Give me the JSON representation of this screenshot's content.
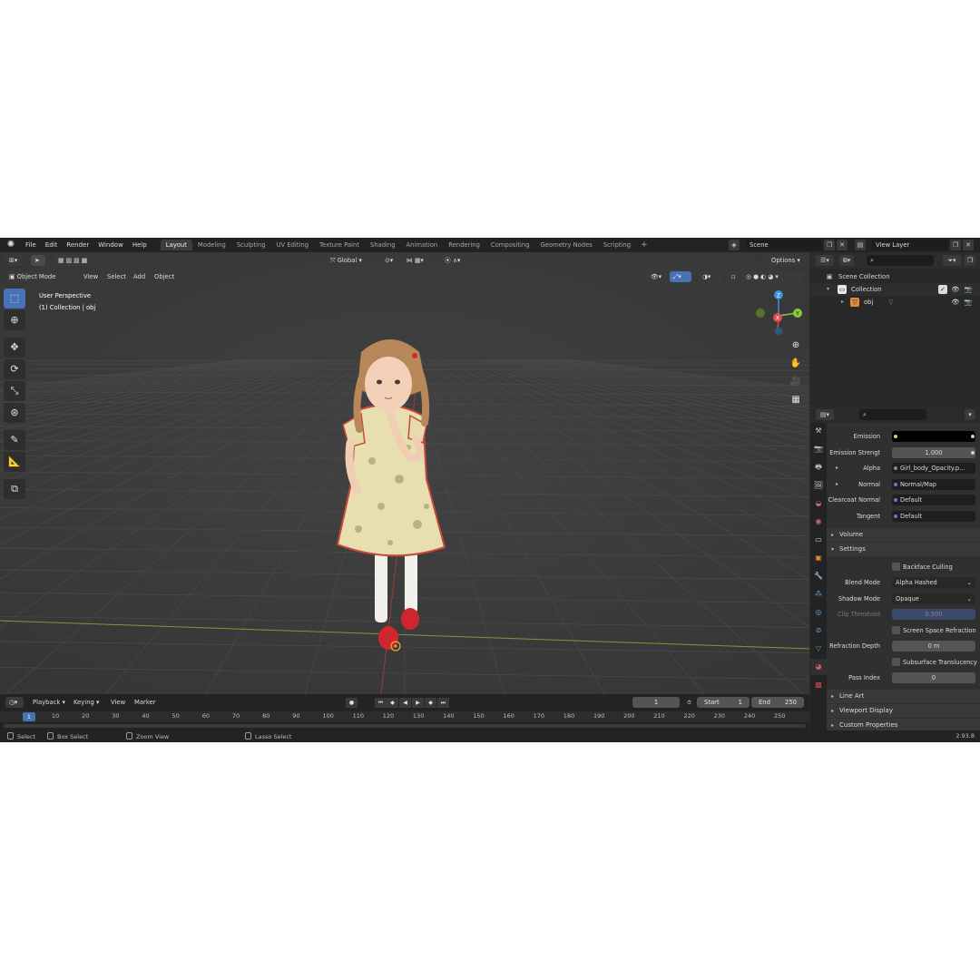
{
  "topbar": {
    "menus": [
      "File",
      "Edit",
      "Render",
      "Window",
      "Help"
    ],
    "workspace_tabs": [
      "Layout",
      "Modeling",
      "Sculpting",
      "UV Editing",
      "Texture Paint",
      "Shading",
      "Animation",
      "Rendering",
      "Compositing",
      "Geometry Nodes",
      "Scripting"
    ],
    "active_tab": "Layout",
    "add_tab": "+",
    "scene": "Scene",
    "view_layer": "View Layer"
  },
  "viewport": {
    "mode": "Object Mode",
    "menus": [
      "View",
      "Select",
      "Add",
      "Object"
    ],
    "transform_orientation": "Global",
    "options": "Options",
    "info_line1": "User Perspective",
    "info_line2": "(1) Collection | obj",
    "gizmo": {
      "z": "Z",
      "y": "Y",
      "x": "X"
    }
  },
  "timeline": {
    "menus": [
      "Playback",
      "Keying",
      "View",
      "Marker"
    ],
    "current_frame": "1",
    "start_label": "Start",
    "start_value": "1",
    "end_label": "End",
    "end_value": "250",
    "ticks": [
      "1",
      "10",
      "20",
      "30",
      "40",
      "50",
      "60",
      "70",
      "80",
      "90",
      "100",
      "110",
      "120",
      "130",
      "140",
      "150",
      "160",
      "170",
      "180",
      "190",
      "200",
      "210",
      "220",
      "230",
      "240",
      "250"
    ]
  },
  "statusbar": {
    "select": "Select",
    "box_select": "Box Select",
    "zoom_view": "Zoom View",
    "lasso_select": "Lasso Select",
    "version": "2.93.8"
  },
  "outliner": {
    "scene_collection": "Scene Collection",
    "collection": "Collection",
    "object": "obj"
  },
  "properties": {
    "emission": {
      "label": "Emission",
      "value": ""
    },
    "emission_strength": {
      "label": "Emission Strengt",
      "value": "1.000"
    },
    "alpha": {
      "label": "Alpha",
      "value": "Girl_body_Opacity.p..."
    },
    "normal": {
      "label": "Normal",
      "value": "Normal/Map"
    },
    "clearcoat_normal": {
      "label": "Clearcoat Normal",
      "value": "Default"
    },
    "tangent": {
      "label": "Tangent",
      "value": "Default"
    },
    "volume_section": "Volume",
    "settings_section": "Settings",
    "backface_culling": "Backface Culling",
    "blend_mode": {
      "label": "Blend Mode",
      "value": "Alpha Hashed"
    },
    "shadow_mode": {
      "label": "Shadow Mode",
      "value": "Opaque"
    },
    "clip_threshold": {
      "label": "Clip Threshold",
      "value": "0.500"
    },
    "screen_space_refraction": "Screen Space Refraction",
    "refraction_depth": {
      "label": "Refraction Depth",
      "value": "0 m"
    },
    "subsurface_translucency": "Subsurface Translucency",
    "pass_index": {
      "label": "Pass Index",
      "value": "0"
    },
    "line_art_section": "Line Art",
    "viewport_display_section": "Viewport Display",
    "custom_properties_section": "Custom Properties"
  },
  "colors": {
    "accent": "#4772b3",
    "x_axis": "#e04a4a",
    "y_axis": "#8cc63f",
    "z_axis": "#3f8fdb"
  }
}
